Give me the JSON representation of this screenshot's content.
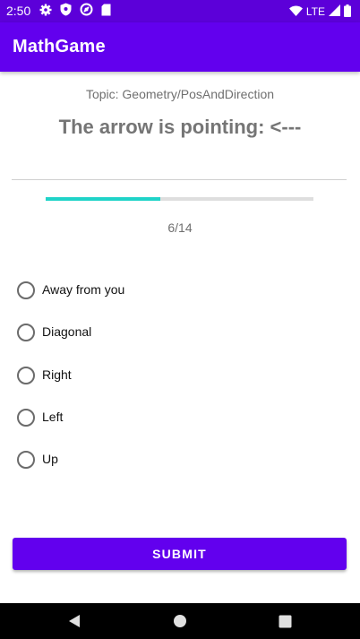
{
  "status_bar": {
    "time": "2:50",
    "network": "LTE",
    "icons": [
      "gear-icon",
      "shield-icon",
      "sync-icon",
      "sd-card-icon",
      "wifi-icon",
      "signal-icon",
      "battery-icon"
    ]
  },
  "app_bar": {
    "title": "MathGame"
  },
  "quiz": {
    "topic": "Topic: Geometry/PosAndDirection",
    "question": "The arrow is pointing: <---",
    "progress_text": "6/14",
    "progress_fraction": 0.4286,
    "options": [
      {
        "label": "Away from you",
        "selected": false
      },
      {
        "label": "Diagonal",
        "selected": false
      },
      {
        "label": "Right",
        "selected": false
      },
      {
        "label": "Left",
        "selected": false
      },
      {
        "label": "Up",
        "selected": false
      }
    ],
    "submit_label": "SUBMIT"
  },
  "colors": {
    "primary": "#6200ee",
    "primary_dark": "#5c00d9",
    "progress_fill": "#1fd3c8",
    "progress_track": "#dedede"
  },
  "nav_bar": {
    "icons": [
      "back-icon",
      "home-icon",
      "recents-icon"
    ]
  }
}
